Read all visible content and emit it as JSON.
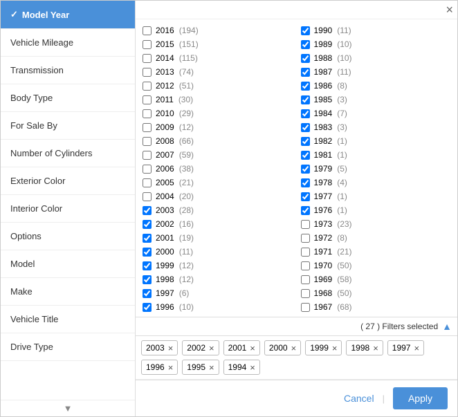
{
  "sidebar": {
    "items": [
      {
        "label": "Model Year",
        "id": "model-year",
        "active": true
      },
      {
        "label": "Vehicle Mileage",
        "id": "vehicle-mileage"
      },
      {
        "label": "Transmission",
        "id": "transmission"
      },
      {
        "label": "Body Type",
        "id": "body-type"
      },
      {
        "label": "For Sale By",
        "id": "for-sale-by"
      },
      {
        "label": "Number of Cylinders",
        "id": "number-of-cylinders"
      },
      {
        "label": "Exterior Color",
        "id": "exterior-color"
      },
      {
        "label": "Interior Color",
        "id": "interior-color"
      },
      {
        "label": "Options",
        "id": "options"
      },
      {
        "label": "Model",
        "id": "model"
      },
      {
        "label": "Make",
        "id": "make"
      },
      {
        "label": "Vehicle Title",
        "id": "vehicle-title"
      },
      {
        "label": "Drive Type",
        "id": "drive-type"
      }
    ]
  },
  "main": {
    "close_label": "×",
    "filters_selected_label": "( 27 ) Filters selected",
    "years": [
      {
        "year": "2016",
        "count": "(194)",
        "checked": false
      },
      {
        "year": "2015",
        "count": "(151)",
        "checked": false
      },
      {
        "year": "2014",
        "count": "(115)",
        "checked": false
      },
      {
        "year": "2013",
        "count": "(74)",
        "checked": false
      },
      {
        "year": "2012",
        "count": "(51)",
        "checked": false
      },
      {
        "year": "2011",
        "count": "(30)",
        "checked": false
      },
      {
        "year": "2010",
        "count": "(29)",
        "checked": false
      },
      {
        "year": "2009",
        "count": "(12)",
        "checked": false
      },
      {
        "year": "2008",
        "count": "(66)",
        "checked": false
      },
      {
        "year": "2007",
        "count": "(59)",
        "checked": false
      },
      {
        "year": "2006",
        "count": "(38)",
        "checked": false
      },
      {
        "year": "2005",
        "count": "(21)",
        "checked": false
      },
      {
        "year": "2004",
        "count": "(20)",
        "checked": false
      },
      {
        "year": "2003",
        "count": "(28)",
        "checked": true
      },
      {
        "year": "2002",
        "count": "(16)",
        "checked": true
      },
      {
        "year": "2001",
        "count": "(19)",
        "checked": true
      },
      {
        "year": "2000",
        "count": "(11)",
        "checked": true
      },
      {
        "year": "1999",
        "count": "(12)",
        "checked": true
      },
      {
        "year": "1998",
        "count": "(12)",
        "checked": true
      },
      {
        "year": "1997",
        "count": "(6)",
        "checked": true
      },
      {
        "year": "1996",
        "count": "(10)",
        "checked": true
      }
    ],
    "years_right": [
      {
        "year": "1990",
        "count": "(11)",
        "checked": true
      },
      {
        "year": "1989",
        "count": "(10)",
        "checked": true
      },
      {
        "year": "1988",
        "count": "(10)",
        "checked": true
      },
      {
        "year": "1987",
        "count": "(11)",
        "checked": true
      },
      {
        "year": "1986",
        "count": "(8)",
        "checked": true
      },
      {
        "year": "1985",
        "count": "(3)",
        "checked": true
      },
      {
        "year": "1984",
        "count": "(7)",
        "checked": true
      },
      {
        "year": "1983",
        "count": "(3)",
        "checked": true
      },
      {
        "year": "1982",
        "count": "(1)",
        "checked": true
      },
      {
        "year": "1981",
        "count": "(1)",
        "checked": true
      },
      {
        "year": "1979",
        "count": "(5)",
        "checked": true
      },
      {
        "year": "1978",
        "count": "(4)",
        "checked": true
      },
      {
        "year": "1977",
        "count": "(1)",
        "checked": true
      },
      {
        "year": "1976",
        "count": "(1)",
        "checked": true
      },
      {
        "year": "1973",
        "count": "(23)",
        "checked": false
      },
      {
        "year": "1972",
        "count": "(8)",
        "checked": false
      },
      {
        "year": "1971",
        "count": "(21)",
        "checked": false
      },
      {
        "year": "1970",
        "count": "(50)",
        "checked": false
      },
      {
        "year": "1969",
        "count": "(58)",
        "checked": false
      },
      {
        "year": "1968",
        "count": "(50)",
        "checked": false
      },
      {
        "year": "1967",
        "count": "(68)",
        "checked": false
      }
    ],
    "tags": [
      "2003",
      "2002",
      "2001",
      "2000",
      "1999",
      "1998",
      "1997",
      "1996",
      "1995",
      "1994"
    ]
  },
  "footer": {
    "cancel_label": "Cancel",
    "apply_label": "Apply",
    "separator": "|"
  }
}
